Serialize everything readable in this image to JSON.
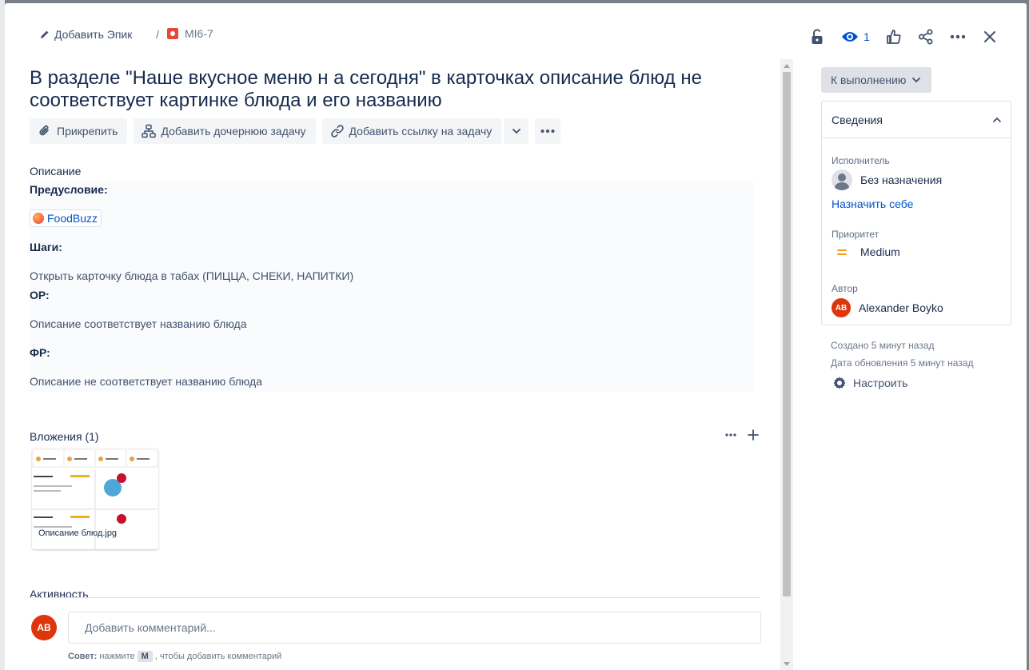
{
  "header": {
    "epic_label": "Добавить Эпик",
    "separator": "/",
    "issue_key": "MI6-7",
    "watch_count": "1"
  },
  "issue": {
    "title": "В разделе \"Наше вкусное меню н а сегодня\" в карточках описание блюд не соответствует картинке блюда и его названию"
  },
  "toolbar": {
    "attach": "Прикрепить",
    "add_child": "Добавить дочернюю задачу",
    "add_link": "Добавить ссылку на задачу"
  },
  "description": {
    "label": "Описание",
    "precondition_heading": "Предусловие:",
    "link_chip": "FoodBuzz",
    "steps_heading": "Шаги:",
    "steps_text": "Открыть карточку блюда в табах (ПИЦЦА, СНЕКИ, НАПИТКИ)",
    "expected_heading": "ОР:",
    "expected_text": "Описание соответствует названию блюда",
    "actual_heading": "ФР:",
    "actual_text": "Описание не соответствует названию блюда"
  },
  "attachments": {
    "label": "Вложения (1)",
    "files": [
      {
        "name": "Описание блюд.jpg"
      }
    ]
  },
  "activity": {
    "label": "Активность"
  },
  "comment": {
    "avatar_initials": "AB",
    "placeholder": "Добавить комментарий...",
    "tip_prefix": "Совет:",
    "tip_middle": "нажмите",
    "tip_key": "M",
    "tip_suffix": ", чтобы добавить комментарий"
  },
  "sidebar": {
    "status": "К выполнению",
    "details_title": "Сведения",
    "assignee_label": "Исполнитель",
    "assignee_value": "Без назначения",
    "assign_self": "Назначить себе",
    "priority_label": "Приоритет",
    "priority_value": "Medium",
    "reporter_label": "Автор",
    "reporter_initials": "AB",
    "reporter_value": "Alexander Boyko",
    "created": "Создано 5 минут назад",
    "updated": "Дата обновления 5 минут назад",
    "configure": "Настроить"
  },
  "colors": {
    "accent": "#0052cc",
    "bug": "#e5493a",
    "avatar": "#de350b",
    "priority_medium": "#ff991f"
  }
}
